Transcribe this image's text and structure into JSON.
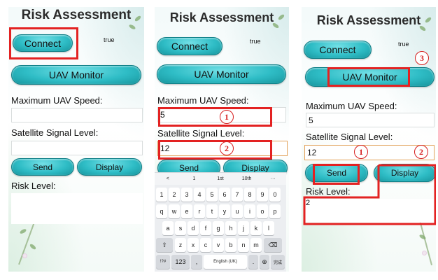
{
  "app": {
    "title": "Risk Assessment"
  },
  "panel1": {
    "connect_label": "Connect",
    "status": "true",
    "monitor_label": "UAV Monitor",
    "speed_label": "Maximum UAV Speed:",
    "speed_value": "",
    "satellite_label": "Satellite Signal Level:",
    "satellite_value": "",
    "send_label": "Send",
    "display_label": "Display",
    "risk_label": "Risk Level:",
    "risk_value": ""
  },
  "panel2": {
    "connect_label": "Connect",
    "status": "true",
    "monitor_label": "UAV Monitor",
    "speed_label": "Maximum UAV Speed:",
    "speed_value": "5",
    "satellite_label": "Satellite Signal Level:",
    "satellite_value": "12",
    "send_label": "Send",
    "display_label": "Display",
    "callouts": [
      "1",
      "2"
    ],
    "keyboard": {
      "suggestions": [
        "<",
        "1",
        "1st",
        "10th",
        "···"
      ],
      "number_row": [
        "1",
        "2",
        "3",
        "4",
        "5",
        "6",
        "7",
        "8",
        "9",
        "0"
      ],
      "row1": [
        "q",
        "w",
        "e",
        "r",
        "t",
        "y",
        "u",
        "i",
        "o",
        "p"
      ],
      "row2": [
        "a",
        "s",
        "d",
        "f",
        "g",
        "h",
        "j",
        "k",
        "l"
      ],
      "row3": [
        "z",
        "x",
        "c",
        "v",
        "b",
        "n",
        "m"
      ],
      "shift": "⇧",
      "backspace": "⌫",
      "symbols": "!?#",
      "numbers": "123",
      "comma": ",",
      "space": "English (UK)",
      "period": ".",
      "globe": "⊕",
      "enter": "完成"
    }
  },
  "panel3": {
    "connect_label": "Connect",
    "status": "true",
    "monitor_label": "UAV Monitor",
    "speed_label": "Maximum UAV Speed:",
    "speed_value": "5",
    "satellite_label": "Satellite Signal Level:",
    "satellite_value": "12",
    "send_label": "Send",
    "display_label": "Display",
    "risk_label": "Risk Level:",
    "risk_value": "2",
    "callouts": [
      "1",
      "2",
      "3"
    ]
  },
  "colors": {
    "button": "#2fbdc6",
    "highlight": "#e32222",
    "focus_border": "#e2a25a"
  }
}
